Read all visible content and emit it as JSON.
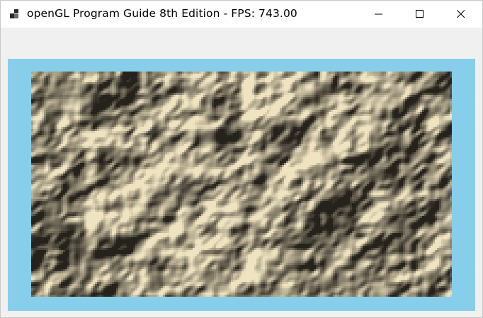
{
  "window": {
    "title": "openGL Program Guide 8th Edition - FPS: 743.00",
    "icon": "app-window-icon",
    "controls": {
      "minimize": "minimize-icon",
      "maximize": "maximize-icon",
      "close": "close-icon"
    }
  },
  "viewport": {
    "clear_color": "#87ceeb",
    "content": "rock-texture-quad",
    "texture_colors": {
      "dark": "#3a3424",
      "mid": "#8c8468",
      "light": "#d8d2bc",
      "highlight": "#f4f2ea"
    }
  }
}
